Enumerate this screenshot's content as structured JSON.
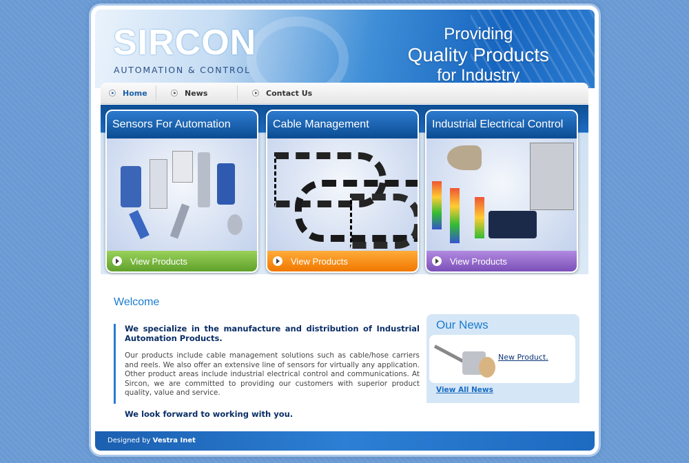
{
  "header": {
    "logo": "SIRCON",
    "logo_sub": "AUTOMATION & CONTROL",
    "slogan": [
      "Providing",
      "Quality Products",
      "for Industry"
    ]
  },
  "nav": [
    {
      "label": "Home",
      "active": true
    },
    {
      "label": "News",
      "active": false
    },
    {
      "label": "Contact Us",
      "active": false
    }
  ],
  "products": [
    {
      "title": "Sensors For Automation",
      "cta": "View Products",
      "color": "green"
    },
    {
      "title": "Cable Management",
      "cta": "View Products",
      "color": "orange"
    },
    {
      "title": "Industrial Electrical Control",
      "cta": "View Products",
      "color": "purple"
    }
  ],
  "welcome": {
    "heading": "Welcome",
    "lead": "We specialize in the manufacture and distribution of Industrial Automation Products.",
    "body": "Our products include cable management solutions such as cable/hose carriers and reels. We also offer an extensive line of sensors for virtually any application. Other product areas include industrial electrical control and communications. At Sircon, we are committed to providing our customers with superior product quality, value and service.",
    "closing": "We look forward to working with you."
  },
  "news": {
    "heading": "Our News",
    "item": "New Product.",
    "view_all": "View All News"
  },
  "footer": {
    "prefix": "Designed by",
    "designer": "Vestra Inet"
  },
  "colors": {
    "accent": "#1a7ccf",
    "green": "#5fa12b",
    "orange": "#f07800",
    "purple": "#7b4fb8"
  }
}
